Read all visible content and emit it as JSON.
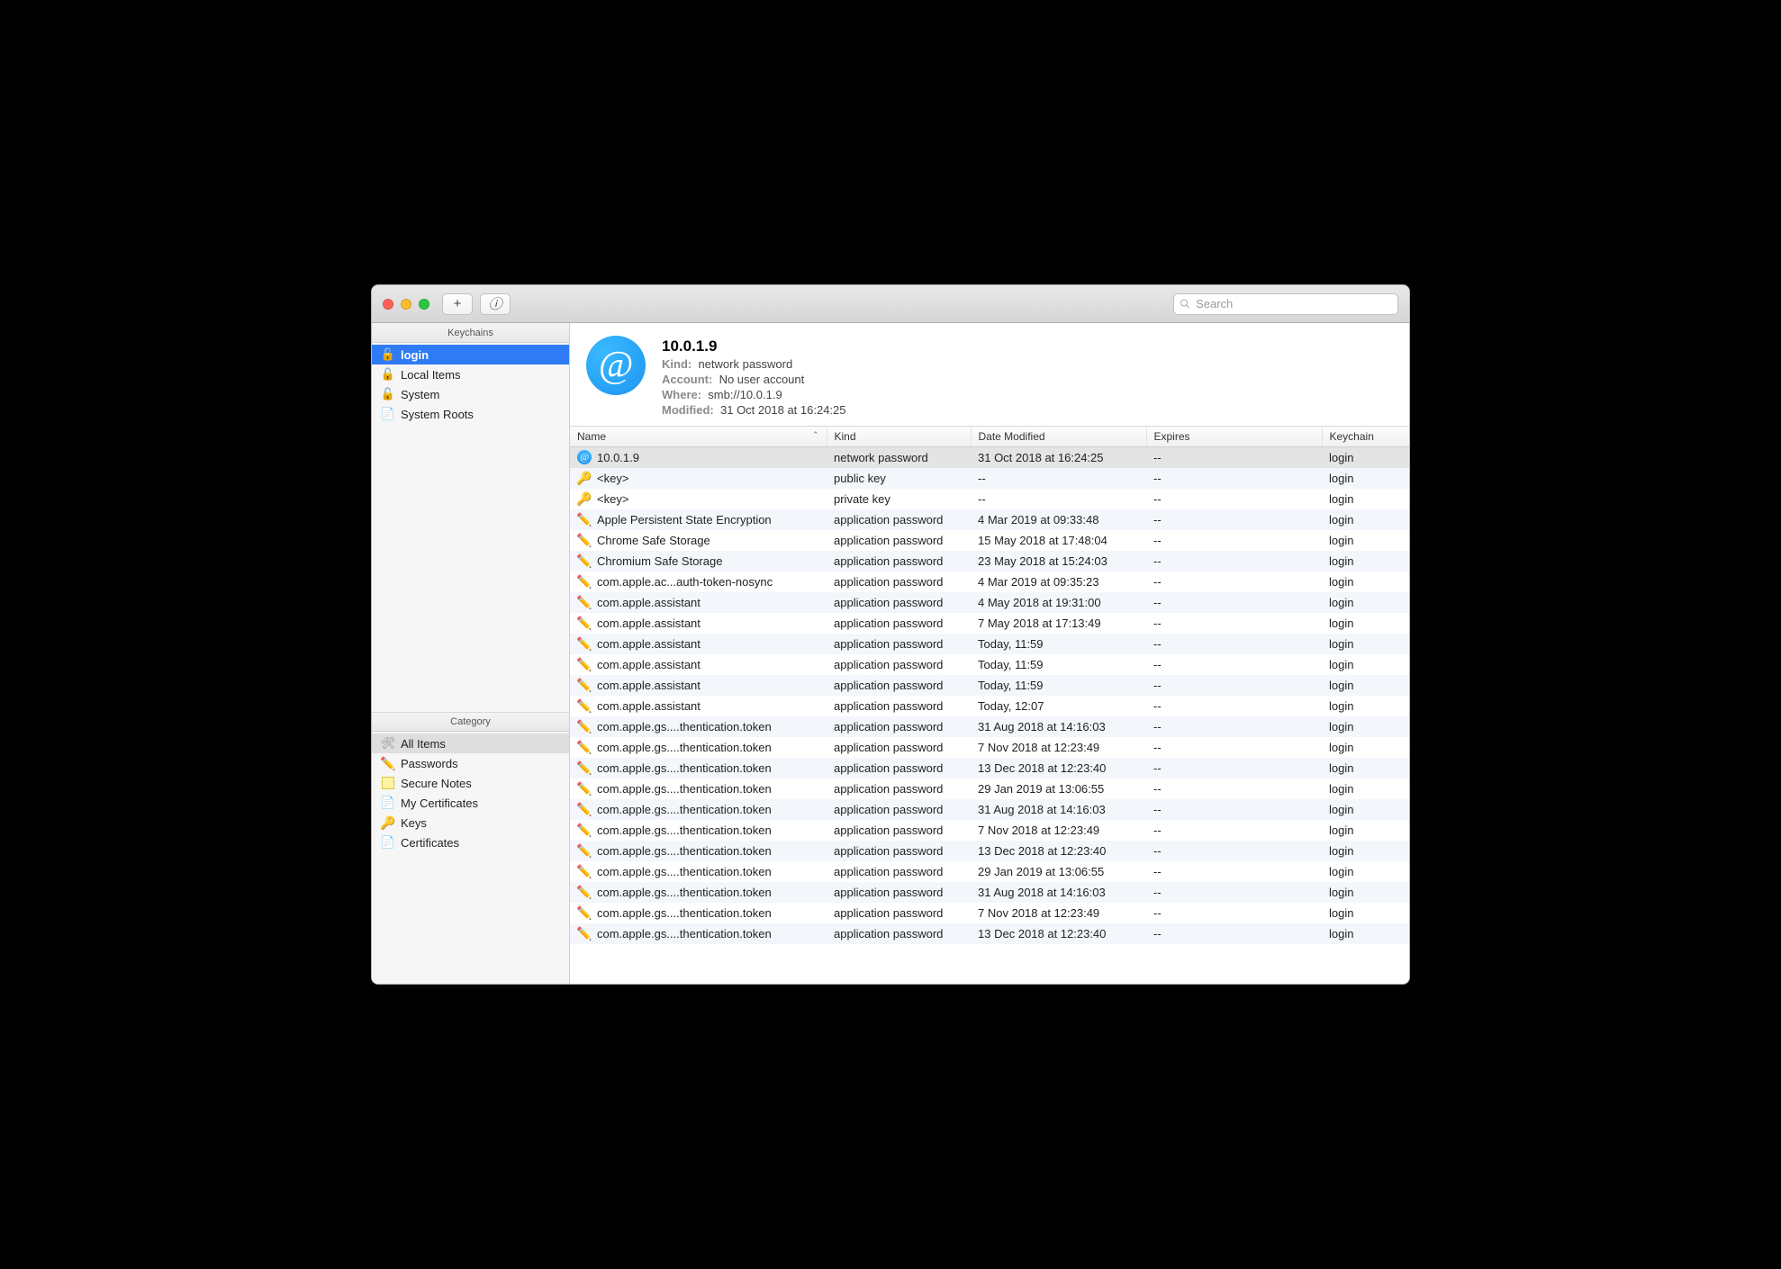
{
  "toolbar": {
    "add_label": "+",
    "info_label": "ⓘ",
    "search_placeholder": "Search"
  },
  "sidebar": {
    "keychains_title": "Keychains",
    "category_title": "Category",
    "keychains": [
      {
        "label": "login",
        "icon": "lock-open",
        "selected": true
      },
      {
        "label": "Local Items",
        "icon": "lock-open"
      },
      {
        "label": "System",
        "icon": "lock-open"
      },
      {
        "label": "System Roots",
        "icon": "cal"
      }
    ],
    "categories": [
      {
        "label": "All Items",
        "icon": "keys",
        "selected": true
      },
      {
        "label": "Passwords",
        "icon": "pencil"
      },
      {
        "label": "Secure Notes",
        "icon": "note"
      },
      {
        "label": "My Certificates",
        "icon": "cal"
      },
      {
        "label": "Keys",
        "icon": "key"
      },
      {
        "label": "Certificates",
        "icon": "cal"
      }
    ]
  },
  "detail": {
    "title": "10.0.1.9",
    "kind_label": "Kind:",
    "kind": "network password",
    "account_label": "Account:",
    "account": "No user account",
    "where_label": "Where:",
    "where": "smb://10.0.1.9",
    "modified_label": "Modified:",
    "modified": "31 Oct 2018 at 16:24:25"
  },
  "columns": {
    "name": "Name",
    "kind": "Kind",
    "date": "Date Modified",
    "expires": "Expires",
    "keychain": "Keychain"
  },
  "rows": [
    {
      "icon": "at",
      "name": "10.0.1.9",
      "kind": "network password",
      "date": "31 Oct 2018 at 16:24:25",
      "expires": "--",
      "keychain": "login",
      "sel": true
    },
    {
      "icon": "key",
      "name": "<key>",
      "kind": "public key",
      "date": "--",
      "expires": "--",
      "keychain": "login"
    },
    {
      "icon": "key",
      "name": "<key>",
      "kind": "private key",
      "date": "--",
      "expires": "--",
      "keychain": "login"
    },
    {
      "icon": "pencil",
      "name": "Apple Persistent State Encryption",
      "kind": "application password",
      "date": "4 Mar 2019 at 09:33:48",
      "expires": "--",
      "keychain": "login"
    },
    {
      "icon": "pencil",
      "name": "Chrome Safe Storage",
      "kind": "application password",
      "date": "15 May 2018 at 17:48:04",
      "expires": "--",
      "keychain": "login"
    },
    {
      "icon": "pencil",
      "name": "Chromium Safe Storage",
      "kind": "application password",
      "date": "23 May 2018 at 15:24:03",
      "expires": "--",
      "keychain": "login"
    },
    {
      "icon": "pencil",
      "name": "com.apple.ac...auth-token-nosync",
      "kind": "application password",
      "date": "4 Mar 2019 at 09:35:23",
      "expires": "--",
      "keychain": "login"
    },
    {
      "icon": "pencil",
      "name": "com.apple.assistant",
      "kind": "application password",
      "date": "4 May 2018 at 19:31:00",
      "expires": "--",
      "keychain": "login"
    },
    {
      "icon": "pencil",
      "name": "com.apple.assistant",
      "kind": "application password",
      "date": "7 May 2018 at 17:13:49",
      "expires": "--",
      "keychain": "login"
    },
    {
      "icon": "pencil",
      "name": "com.apple.assistant",
      "kind": "application password",
      "date": "Today, 11:59",
      "expires": "--",
      "keychain": "login"
    },
    {
      "icon": "pencil",
      "name": "com.apple.assistant",
      "kind": "application password",
      "date": "Today, 11:59",
      "expires": "--",
      "keychain": "login"
    },
    {
      "icon": "pencil",
      "name": "com.apple.assistant",
      "kind": "application password",
      "date": "Today, 11:59",
      "expires": "--",
      "keychain": "login"
    },
    {
      "icon": "pencil",
      "name": "com.apple.assistant",
      "kind": "application password",
      "date": "Today, 12:07",
      "expires": "--",
      "keychain": "login"
    },
    {
      "icon": "pencil",
      "name": "com.apple.gs....thentication.token",
      "kind": "application password",
      "date": "31 Aug 2018 at 14:16:03",
      "expires": "--",
      "keychain": "login"
    },
    {
      "icon": "pencil",
      "name": "com.apple.gs....thentication.token",
      "kind": "application password",
      "date": "7 Nov 2018 at 12:23:49",
      "expires": "--",
      "keychain": "login"
    },
    {
      "icon": "pencil",
      "name": "com.apple.gs....thentication.token",
      "kind": "application password",
      "date": "13 Dec 2018 at 12:23:40",
      "expires": "--",
      "keychain": "login"
    },
    {
      "icon": "pencil",
      "name": "com.apple.gs....thentication.token",
      "kind": "application password",
      "date": "29 Jan 2019 at 13:06:55",
      "expires": "--",
      "keychain": "login"
    },
    {
      "icon": "pencil",
      "name": "com.apple.gs....thentication.token",
      "kind": "application password",
      "date": "31 Aug 2018 at 14:16:03",
      "expires": "--",
      "keychain": "login"
    },
    {
      "icon": "pencil",
      "name": "com.apple.gs....thentication.token",
      "kind": "application password",
      "date": "7 Nov 2018 at 12:23:49",
      "expires": "--",
      "keychain": "login"
    },
    {
      "icon": "pencil",
      "name": "com.apple.gs....thentication.token",
      "kind": "application password",
      "date": "13 Dec 2018 at 12:23:40",
      "expires": "--",
      "keychain": "login"
    },
    {
      "icon": "pencil",
      "name": "com.apple.gs....thentication.token",
      "kind": "application password",
      "date": "29 Jan 2019 at 13:06:55",
      "expires": "--",
      "keychain": "login"
    },
    {
      "icon": "pencil",
      "name": "com.apple.gs....thentication.token",
      "kind": "application password",
      "date": "31 Aug 2018 at 14:16:03",
      "expires": "--",
      "keychain": "login"
    },
    {
      "icon": "pencil",
      "name": "com.apple.gs....thentication.token",
      "kind": "application password",
      "date": "7 Nov 2018 at 12:23:49",
      "expires": "--",
      "keychain": "login"
    },
    {
      "icon": "pencil",
      "name": "com.apple.gs....thentication.token",
      "kind": "application password",
      "date": "13 Dec 2018 at 12:23:40",
      "expires": "--",
      "keychain": "login"
    }
  ]
}
